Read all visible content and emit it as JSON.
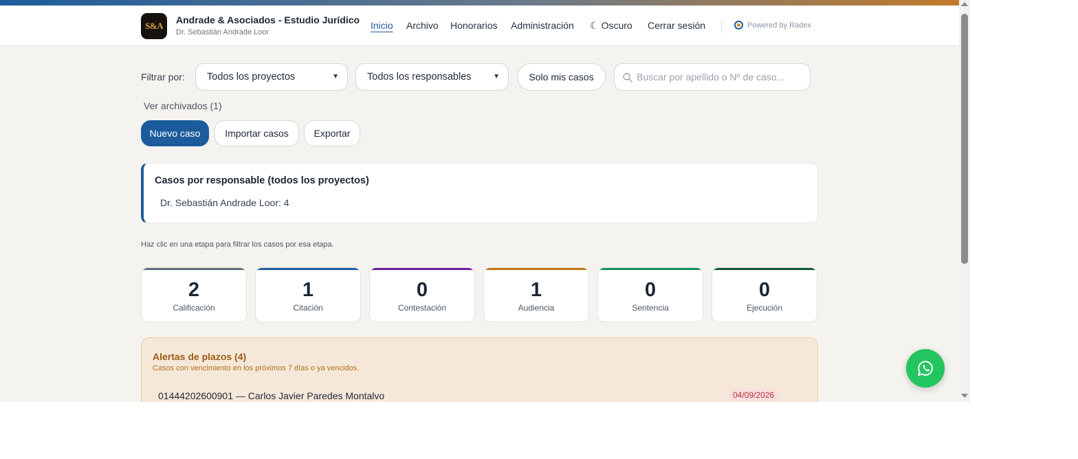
{
  "header": {
    "logo_text": "S&A",
    "title": "Andrade & Asociados - Estudio Jurídico",
    "subtitle": "Dr. Sebastián Andrade Loor",
    "nav": {
      "inicio": "Inicio",
      "archivo": "Archivo",
      "honorarios": "Honorarios",
      "administracion": "Administración",
      "oscuro": "Oscuro",
      "cerrar_sesion": "Cerrar sesión"
    },
    "powered_by": "Powered by Radex"
  },
  "filters": {
    "label": "Filtrar por:",
    "project_select": "Todos los proyectos",
    "responsible_select": "Todos los responsables",
    "only_mine": "Solo mis casos",
    "search_placeholder": "Buscar por apellido o Nº de caso..."
  },
  "archived_link": "Ver archivados (1)",
  "actions": {
    "new_case": "Nuevo caso",
    "import": "Importar casos",
    "export": "Exportar"
  },
  "summary": {
    "title": "Casos por responsable (todos los proyectos)",
    "rows": [
      "Dr. Sebastián Andrade Loor: 4"
    ]
  },
  "stage_hint": "Haz clic en una etapa para filtrar los casos por esa etapa.",
  "stages": [
    {
      "count": "2",
      "label": "Calificación",
      "color": "#5f6b7a"
    },
    {
      "count": "1",
      "label": "Citación",
      "color": "#1d5c9c"
    },
    {
      "count": "0",
      "label": "Contestación",
      "color": "#6b21a8"
    },
    {
      "count": "1",
      "label": "Audiencia",
      "color": "#c2740f"
    },
    {
      "count": "0",
      "label": "Sentencia",
      "color": "#15935a"
    },
    {
      "count": "0",
      "label": "Ejecución",
      "color": "#0f5a3a"
    }
  ],
  "alerts": {
    "title": "Alertas de plazos (4)",
    "subtitle": "Casos con vencimiento en los próximos 7 días o ya vencidos.",
    "items": [
      {
        "text": "01444202600901 — Carlos Javier Paredes Montalvo",
        "date": "04/09/2026"
      }
    ]
  },
  "colors": {
    "accent": "#1d5c9c",
    "alert_bg": "#f6e8d9",
    "alert_title": "#9a5b13",
    "whatsapp": "#22c55e"
  },
  "icons": {
    "search": "search-icon",
    "moon": "moon-icon",
    "whatsapp": "whatsapp-icon",
    "chevron": "chevron-down-icon",
    "powered": "radex-logo-icon"
  }
}
